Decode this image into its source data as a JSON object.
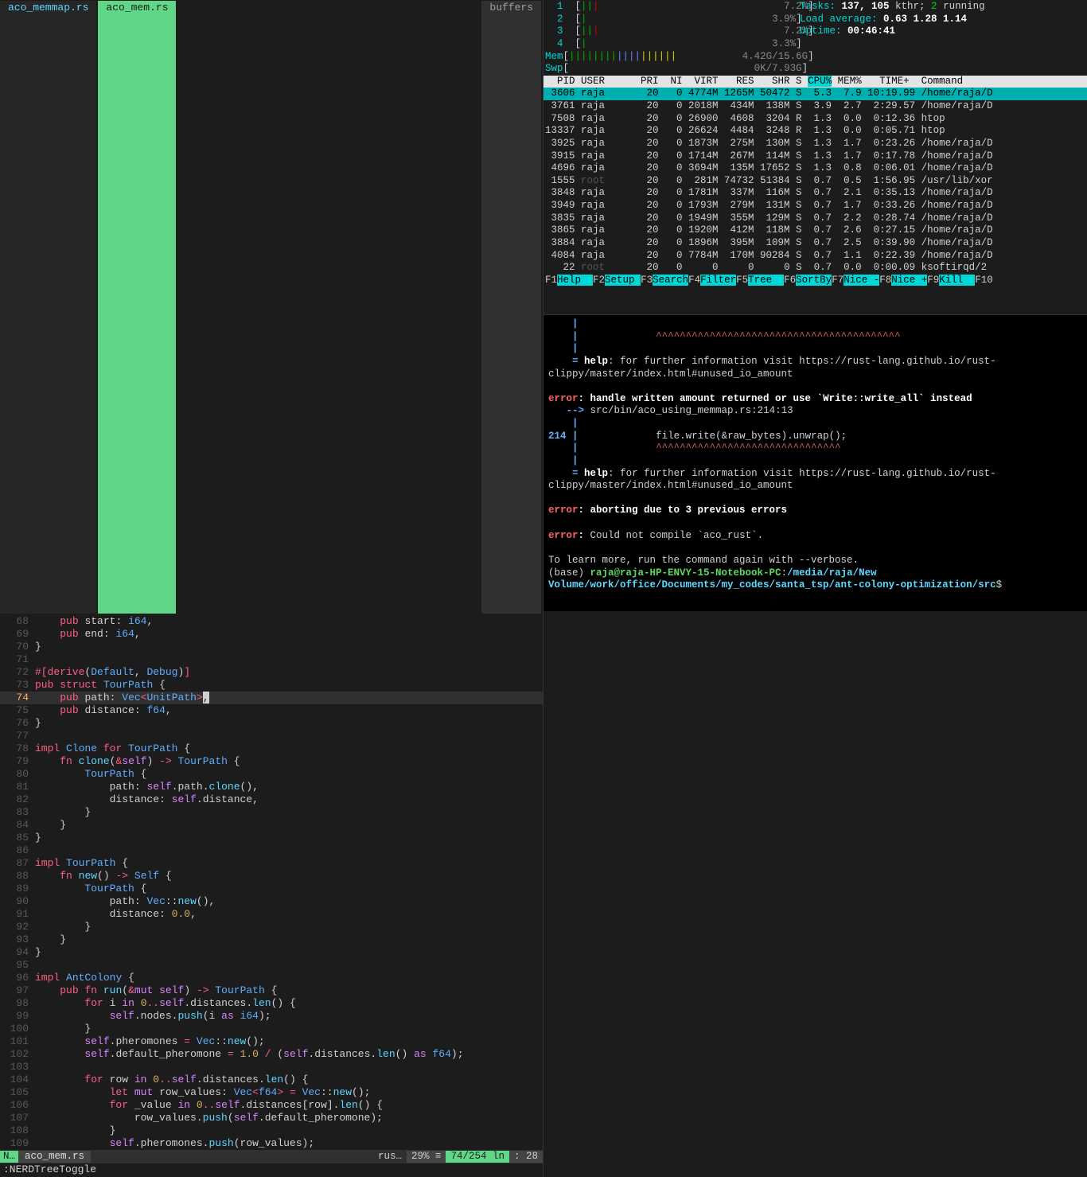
{
  "tabs": {
    "inactive": " aco_memmap.rs ",
    "active": " aco_mem.rs ",
    "right": "buffers"
  },
  "code": [
    {
      "n": "68",
      "hl": false,
      "html": "    <span class='kw'>pub</span> <span class='ident'>start</span><span class='punct'>:</span> <span class='ty'>i64</span><span class='punct'>,</span>"
    },
    {
      "n": "69",
      "hl": false,
      "html": "    <span class='kw'>pub</span> <span class='ident'>end</span><span class='punct'>:</span> <span class='ty'>i64</span><span class='punct'>,</span>"
    },
    {
      "n": "70",
      "hl": false,
      "html": "<span class='punct'>}</span>"
    },
    {
      "n": "71",
      "hl": false,
      "html": ""
    },
    {
      "n": "72",
      "hl": false,
      "html": "<span class='attr'>#[derive</span><span class='punct'>(</span><span class='ty'>Default</span><span class='punct'>, </span><span class='ty'>Debug</span><span class='punct'>)</span><span class='attr'>]</span>"
    },
    {
      "n": "73",
      "hl": false,
      "html": "<span class='kw'>pub</span> <span class='kw'>struct</span> <span class='ty'>TourPath</span> <span class='punct'>{</span>"
    },
    {
      "n": "74",
      "hl": true,
      "html": "    <span class='kw'>pub</span> <span class='ident'>path</span><span class='punct'>:</span> <span class='ty'>Vec</span><span class='op'>&lt;</span><span class='ty'>UnitPath</span><span class='op'>&gt;</span><span class='cursor-box'>,</span>"
    },
    {
      "n": "75",
      "hl": false,
      "html": "    <span class='kw'>pub</span> <span class='ident'>distance</span><span class='punct'>:</span> <span class='ty'>f64</span><span class='punct'>,</span>"
    },
    {
      "n": "76",
      "hl": false,
      "html": "<span class='punct'>}</span>"
    },
    {
      "n": "77",
      "hl": false,
      "html": ""
    },
    {
      "n": "78",
      "hl": false,
      "html": "<span class='kw'>impl</span> <span class='ty'>Clone</span> <span class='kw'>for</span> <span class='ty'>TourPath</span> <span class='punct'>{</span>"
    },
    {
      "n": "79",
      "hl": false,
      "html": "    <span class='kw'>fn</span> <span class='fnname'>clone</span><span class='punct'>(</span><span class='op'>&amp;</span><span class='kw2'>self</span><span class='punct'>)</span> <span class='op'>-&gt;</span> <span class='ty'>TourPath</span> <span class='punct'>{</span>"
    },
    {
      "n": "80",
      "hl": false,
      "html": "        <span class='ty'>TourPath</span> <span class='punct'>{</span>"
    },
    {
      "n": "81",
      "hl": false,
      "html": "            <span class='ident'>path</span><span class='punct'>:</span> <span class='kw2'>self</span><span class='punct'>.</span><span class='ident'>path</span><span class='punct'>.</span><span class='call'>clone</span><span class='punct'>(),</span>"
    },
    {
      "n": "82",
      "hl": false,
      "html": "            <span class='ident'>distance</span><span class='punct'>:</span> <span class='kw2'>self</span><span class='punct'>.</span><span class='ident'>distance</span><span class='punct'>,</span>"
    },
    {
      "n": "83",
      "hl": false,
      "html": "        <span class='punct'>}</span>"
    },
    {
      "n": "84",
      "hl": false,
      "html": "    <span class='punct'>}</span>"
    },
    {
      "n": "85",
      "hl": false,
      "html": "<span class='punct'>}</span>"
    },
    {
      "n": "86",
      "hl": false,
      "html": ""
    },
    {
      "n": "87",
      "hl": false,
      "html": "<span class='kw'>impl</span> <span class='ty'>TourPath</span> <span class='punct'>{</span>"
    },
    {
      "n": "88",
      "hl": false,
      "html": "    <span class='kw'>fn</span> <span class='fnname'>new</span><span class='punct'>()</span> <span class='op'>-&gt;</span> <span class='ty'>Self</span> <span class='punct'>{</span>"
    },
    {
      "n": "89",
      "hl": false,
      "html": "        <span class='ty'>TourPath</span> <span class='punct'>{</span>"
    },
    {
      "n": "90",
      "hl": false,
      "html": "            <span class='ident'>path</span><span class='punct'>:</span> <span class='ty'>Vec</span><span class='punct'>::</span><span class='call'>new</span><span class='punct'>(),</span>"
    },
    {
      "n": "91",
      "hl": false,
      "html": "            <span class='ident'>distance</span><span class='punct'>:</span> <span class='num'>0.0</span><span class='punct'>,</span>"
    },
    {
      "n": "92",
      "hl": false,
      "html": "        <span class='punct'>}</span>"
    },
    {
      "n": "93",
      "hl": false,
      "html": "    <span class='punct'>}</span>"
    },
    {
      "n": "94",
      "hl": false,
      "html": "<span class='punct'>}</span>"
    },
    {
      "n": "95",
      "hl": false,
      "html": ""
    },
    {
      "n": "96",
      "hl": false,
      "html": "<span class='kw'>impl</span> <span class='ty'>AntColony</span> <span class='punct'>{</span>"
    },
    {
      "n": "97",
      "hl": false,
      "html": "    <span class='kw'>pub</span> <span class='kw'>fn</span> <span class='fnname'>run</span><span class='punct'>(</span><span class='op'>&amp;</span><span class='kw2'>mut</span> <span class='kw2'>self</span><span class='punct'>)</span> <span class='op'>-&gt;</span> <span class='ty'>TourPath</span> <span class='punct'>{</span>"
    },
    {
      "n": "98",
      "hl": false,
      "html": "        <span class='kw'>for</span> <span class='ident'>i</span> <span class='kw2'>in</span> <span class='num'>0</span><span class='op'>..</span><span class='kw2'>self</span><span class='punct'>.</span><span class='ident'>distances</span><span class='punct'>.</span><span class='call'>len</span><span class='punct'>() {</span>"
    },
    {
      "n": "99",
      "hl": false,
      "html": "            <span class='kw2'>self</span><span class='punct'>.</span><span class='ident'>nodes</span><span class='punct'>.</span><span class='call'>push</span><span class='punct'>(</span><span class='ident'>i</span> <span class='kw2'>as</span> <span class='ty'>i64</span><span class='punct'>);</span>"
    },
    {
      "n": "100",
      "hl": false,
      "html": "        <span class='punct'>}</span>"
    },
    {
      "n": "101",
      "hl": false,
      "html": "        <span class='kw2'>self</span><span class='punct'>.</span><span class='ident'>pheromones</span> <span class='op'>=</span> <span class='ty'>Vec</span><span class='punct'>::</span><span class='call'>new</span><span class='punct'>();</span>"
    },
    {
      "n": "102",
      "hl": false,
      "html": "        <span class='kw2'>self</span><span class='punct'>.</span><span class='ident'>default_pheromone</span> <span class='op'>=</span> <span class='num'>1.0</span> <span class='op'>/</span> <span class='punct'>(</span><span class='kw2'>self</span><span class='punct'>.</span><span class='ident'>distances</span><span class='punct'>.</span><span class='call'>len</span><span class='punct'>()</span> <span class='kw2'>as</span> <span class='ty'>f64</span><span class='punct'>);</span>"
    },
    {
      "n": "103",
      "hl": false,
      "html": ""
    },
    {
      "n": "104",
      "hl": false,
      "html": "        <span class='kw'>for</span> <span class='ident'>row</span> <span class='kw2'>in</span> <span class='num'>0</span><span class='op'>..</span><span class='kw2'>self</span><span class='punct'>.</span><span class='ident'>distances</span><span class='punct'>.</span><span class='call'>len</span><span class='punct'>() {</span>"
    },
    {
      "n": "105",
      "hl": false,
      "html": "            <span class='kw'>let</span> <span class='kw2'>mut</span> <span class='ident'>row_values</span><span class='punct'>:</span> <span class='ty'>Vec</span><span class='op'>&lt;</span><span class='ty'>f64</span><span class='op'>&gt;</span> <span class='op'>=</span> <span class='ty'>Vec</span><span class='punct'>::</span><span class='call'>new</span><span class='punct'>();</span>"
    },
    {
      "n": "106",
      "hl": false,
      "html": "            <span class='kw'>for</span> <span class='ident'>_value</span> <span class='kw2'>in</span> <span class='num'>0</span><span class='op'>..</span><span class='kw2'>self</span><span class='punct'>.</span><span class='ident'>distances</span><span class='punct'>[</span><span class='ident'>row</span><span class='punct'>].</span><span class='call'>len</span><span class='punct'>() {</span>"
    },
    {
      "n": "107",
      "hl": false,
      "html": "                <span class='ident'>row_values</span><span class='punct'>.</span><span class='call'>push</span><span class='punct'>(</span><span class='kw2'>self</span><span class='punct'>.</span><span class='ident'>default_pheromone</span><span class='punct'>);</span>"
    },
    {
      "n": "108",
      "hl": false,
      "html": "            <span class='punct'>}</span>"
    },
    {
      "n": "109",
      "hl": false,
      "html": "            <span class='kw2'>self</span><span class='punct'>.</span><span class='ident'>pheromones</span><span class='punct'>.</span><span class='call'>push</span><span class='punct'>(</span><span class='ident'>row_values</span><span class='punct'>);</span>"
    }
  ],
  "status": {
    "mode": "N… ",
    "file": " aco_mem.rs ",
    "ft": " rus… ",
    "pct": " 29% ≡ ",
    "pos": " 74/254 ln ",
    "col": ":  28 "
  },
  "cmdline": ":NERDTreeToggle",
  "htop": {
    "cpus": [
      {
        "n": "1",
        "bar": "||<span class='bar-hi'>|</span>",
        "pct": "7.2%"
      },
      {
        "n": "2",
        "bar": "|",
        "pct": "3.9%"
      },
      {
        "n": "3",
        "bar": "||<span class='bar-hi'>|</span>",
        "pct": "7.2%"
      },
      {
        "n": "4",
        "bar": "|",
        "pct": "3.3%"
      }
    ],
    "mem_label": "Mem",
    "mem_bar": "<span class='bar-low'>||||||||</span><span class='bar-blue'>||||</span><span class='bar-med'>||||||</span>",
    "mem_val": "4.42G/15.6G",
    "swp_label": "Swp",
    "swp_bar": "",
    "swp_val": "0K/7.93G",
    "tasks": "Tasks: ",
    "tasks_v": "137, 105 ",
    "tasks_kthr": "kthr; ",
    "tasks_run": "2 ",
    "tasks_running": "running",
    "load": "Load average: ",
    "load_v": "0.63 1.28 1.14",
    "uptime": "Uptime: ",
    "uptime_v": "00:46:41",
    "header": "  PID USER      PRI  NI  VIRT   RES   SHR S ",
    "header_sort": "CPU%",
    "header2": " MEM%   TIME+  Command",
    "rows": [
      {
        "sel": true,
        "txt": " 3606 raja       20   0 4774M 1265M 50472 S  5.3  7.9 10:19.99 /home/raja/D"
      },
      {
        "sel": false,
        "txt": " 3761 raja       20   0 2018M  434M  138M S  3.9  2.7  2:29.57 /home/raja/D"
      },
      {
        "sel": false,
        "txt": " 7508 raja       20   0 26900  4608  3204 R  1.3  0.0  0:12.36 htop"
      },
      {
        "sel": false,
        "txt": "13337 raja       20   0 26624  4484  3248 R  1.3  0.0  0:05.71 htop"
      },
      {
        "sel": false,
        "txt": " 3925 raja       20   0 1873M  275M  130M S  1.3  1.7  0:23.26 /home/raja/D"
      },
      {
        "sel": false,
        "txt": " 3915 raja       20   0 1714M  267M  114M S  1.3  1.7  0:17.78 /home/raja/D"
      },
      {
        "sel": false,
        "txt": " 4696 raja       20   0 3694M  135M 17652 S  1.3  0.8  0:06.01 /home/raja/D"
      },
      {
        "sel": false,
        "root": true,
        "txt": " 1555 root       20   0  281M 74732 51384 S  0.7  0.5  1:56.95 /usr/lib/xor"
      },
      {
        "sel": false,
        "txt": " 3848 raja       20   0 1781M  337M  116M S  0.7  2.1  0:35.13 /home/raja/D"
      },
      {
        "sel": false,
        "txt": " 3949 raja       20   0 1793M  279M  131M S  0.7  1.7  0:33.26 /home/raja/D"
      },
      {
        "sel": false,
        "txt": " 3835 raja       20   0 1949M  355M  129M S  0.7  2.2  0:28.74 /home/raja/D"
      },
      {
        "sel": false,
        "txt": " 3865 raja       20   0 1920M  412M  118M S  0.7  2.6  0:27.15 /home/raja/D"
      },
      {
        "sel": false,
        "txt": " 3884 raja       20   0 1896M  395M  109M S  0.7  2.5  0:39.90 /home/raja/D"
      },
      {
        "sel": false,
        "txt": " 4084 raja       20   0 7784M  170M 90284 S  0.7  1.1  0:22.39 /home/raja/D"
      },
      {
        "sel": false,
        "root": true,
        "txt": "   22 root       20   0     0     0     0 S  0.7  0.0  0:00.09 ksoftirqd/2"
      }
    ],
    "fkeys": [
      {
        "k": "F1",
        "l": "Help  "
      },
      {
        "k": "F2",
        "l": "Setup "
      },
      {
        "k": "F3",
        "l": "Search"
      },
      {
        "k": "F4",
        "l": "Filter"
      },
      {
        "k": "F5",
        "l": "Tree  "
      },
      {
        "k": "F6",
        "l": "SortBy"
      },
      {
        "k": "F7",
        "l": "Nice -"
      },
      {
        "k": "F8",
        "l": "Nice +"
      },
      {
        "k": "F9",
        "l": "Kill  "
      },
      {
        "k": "F10",
        "l": ""
      }
    ]
  },
  "term": {
    "lines": [
      "    <span class='t-blue'>|</span>",
      "    <span class='t-blue'>|</span>             <span class='t-redw'>^^^^^^^^^^^^^^^^^^^^^^^^^^^^^^^^^^^^^^^^^</span>",
      "    <span class='t-blue'>|</span>",
      "    <span class='t-blue'>=</span> <span class='t-bold'>help</span>: for further information visit https://rust-lang.github.io/rust-clippy/master/index.html#unused_io_amount",
      "",
      "<span class='t-red'>error</span><span class='t-bold'>: handle written amount returned or use `Write::write_all` instead</span>",
      "   <span class='t-blue'>--&gt;</span> src/bin/aco_using_memmap.rs:214:13",
      "    <span class='t-blue'>|</span>",
      "<span class='t-blue'>214</span> <span class='t-blue'>|</span>             file.write(&amp;raw_bytes).unwrap();",
      "    <span class='t-blue'>|</span>             <span class='t-redw'>^^^^^^^^^^^^^^^^^^^^^^^^^^^^^^^</span>",
      "    <span class='t-blue'>|</span>",
      "    <span class='t-blue'>=</span> <span class='t-bold'>help</span>: for further information visit https://rust-lang.github.io/rust-clippy/master/index.html#unused_io_amount",
      "",
      "<span class='t-red'>error</span><span class='t-bold'>: aborting due to 3 previous errors</span>",
      "",
      "<span class='t-red'>error</span><span class='t-bold'>:</span> Could not compile `aco_rust`.",
      "",
      "To learn more, run the command again with --verbose.",
      "(base) <span class='t-green'>raja@raja-HP-ENVY-15-Notebook-PC</span>:<span class='t-cyan'>/media/raja/New Volume/work/office/Documents/my_codes/santa_tsp/ant-colony-optimization/src</span>$"
    ]
  }
}
